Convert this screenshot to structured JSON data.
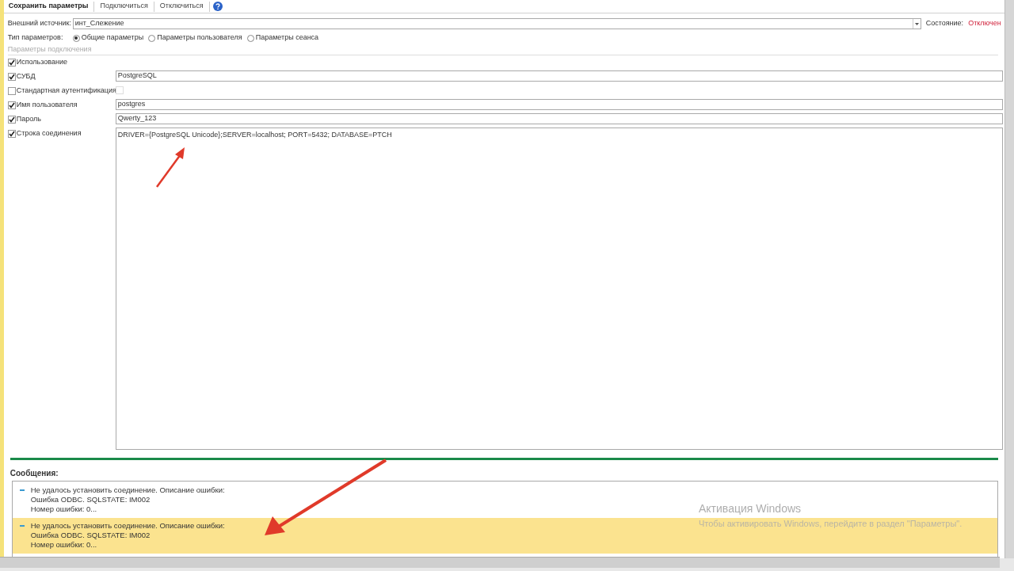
{
  "toolbar": {
    "buttons": [
      {
        "label": "Сохранить параметры",
        "bold": true
      },
      {
        "label": "Подключиться",
        "bold": false
      },
      {
        "label": "Отключиться",
        "bold": false
      }
    ]
  },
  "source": {
    "label": "Внешний источник:",
    "value": "инт_Слежение"
  },
  "state": {
    "label": "Состояние:",
    "value": "Отключен"
  },
  "param_type": {
    "label": "Тип параметров:",
    "options": [
      {
        "label": "Общие параметры",
        "selected": true
      },
      {
        "label": "Параметры пользователя",
        "selected": false
      },
      {
        "label": "Параметры сеанса",
        "selected": false
      }
    ]
  },
  "section_title": "Параметры подключения",
  "params": [
    {
      "kind": "none",
      "label": "Использование",
      "checked": true
    },
    {
      "kind": "text",
      "label": "СУБД",
      "checked": true,
      "value": "PostgreSQL"
    },
    {
      "kind": "flag",
      "label": "Стандартная аутентификация",
      "checked": false,
      "flag_checked": false
    },
    {
      "kind": "text",
      "label": "Имя пользователя",
      "checked": true,
      "value": "postgres"
    },
    {
      "kind": "text",
      "label": "Пароль",
      "checked": true,
      "value": "Qwerty_123"
    },
    {
      "kind": "multiline",
      "label": "Строка соединения",
      "checked": true,
      "value": "DRIVER={PostgreSQL Unicode};SERVER=localhost; PORT=5432; DATABASE=PTCH"
    }
  ],
  "messages_title": "Сообщения:",
  "messages": [
    {
      "selected": false,
      "lines": [
        "Не удалось установить соединение. Описание ошибки:",
        "Ошибка ODBC. SQLSTATE: IM002",
        "Номер ошибки: 0..."
      ]
    },
    {
      "selected": true,
      "lines": [
        "Не удалось установить соединение. Описание ошибки:",
        "Ошибка ODBC. SQLSTATE: IM002",
        "Номер ошибки: 0..."
      ]
    }
  ],
  "activation_notice": {
    "title": "Активация Windows",
    "text": "Чтобы активировать Windows, перейдите в раздел \"Параметры\"."
  }
}
